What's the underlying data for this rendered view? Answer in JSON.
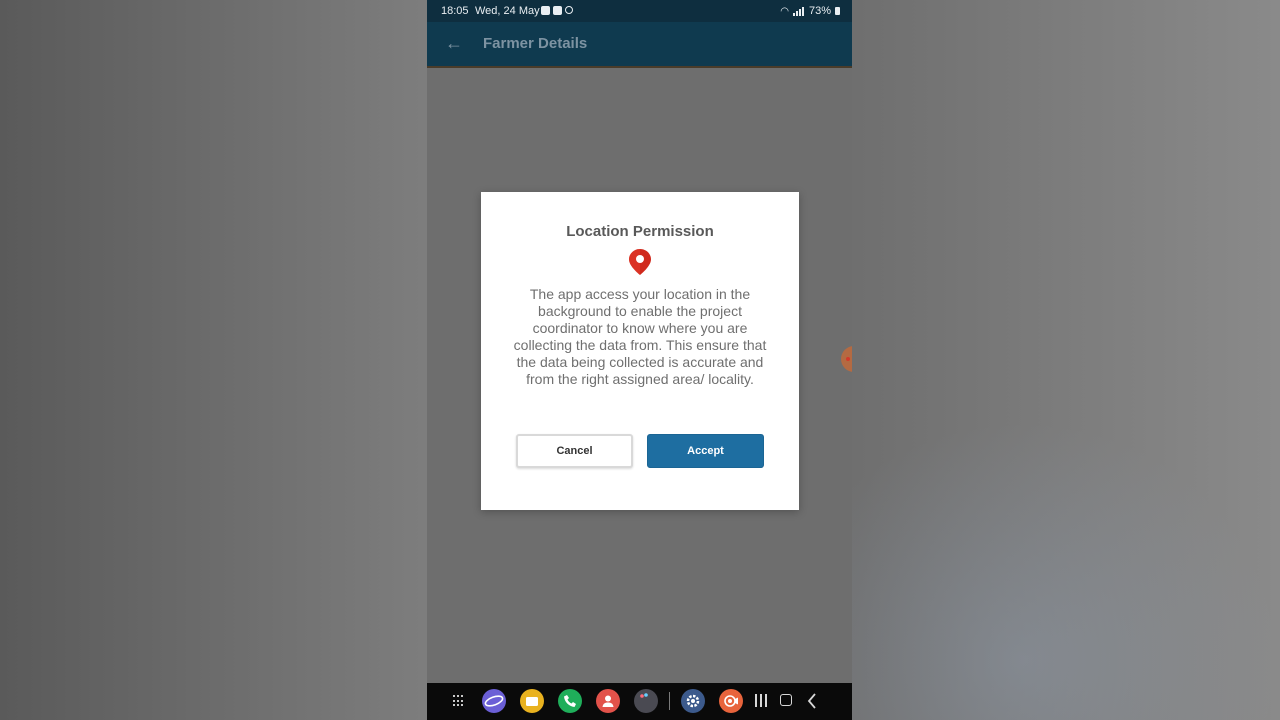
{
  "status_bar": {
    "time": "18:05",
    "date": "Wed, 24 May",
    "battery": "73%"
  },
  "app_bar": {
    "title": "Farmer Details",
    "back_icon": "arrow-left-icon"
  },
  "dialog": {
    "title": "Location Permission",
    "icon": "location-pin-icon",
    "body": "The app access your location in the background to enable the project coordinator to know where you are collecting the data from. This ensure that the data being collected is accurate and from the right assigned area/ locality.",
    "cancel_label": "Cancel",
    "accept_label": "Accept"
  },
  "dock": {
    "apps": [
      {
        "name": "app-drawer-icon"
      },
      {
        "name": "internet-icon",
        "color": "#6b5fd6"
      },
      {
        "name": "my-files-icon",
        "color": "#e9b21f"
      },
      {
        "name": "phone-icon",
        "color": "#1fae5a"
      },
      {
        "name": "contacts-icon",
        "color": "#e2524a"
      },
      {
        "name": "game-launcher-icon",
        "color": "#4a4a52"
      },
      {
        "name": "settings-icon",
        "color": "#3c5a8c"
      },
      {
        "name": "screen-recorder-icon",
        "color": "#e8643c"
      }
    ]
  },
  "colors": {
    "app_bar": "#0f3a4f",
    "accept_button": "#1e6ea1",
    "pin": "#d0291c"
  }
}
